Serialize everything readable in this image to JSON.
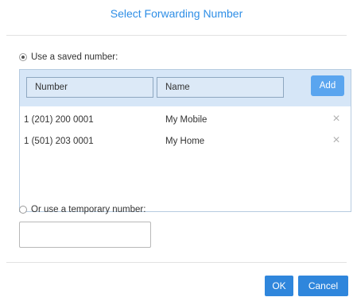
{
  "dialog": {
    "title": "Select Forwarding Number"
  },
  "saved": {
    "radio_label": "Use a saved number:",
    "selected": true,
    "columns": {
      "number": "Number",
      "name": "Name"
    },
    "add_label": "Add",
    "rows": [
      {
        "number": "1 (201) 200 0001",
        "name": "My Mobile",
        "remove_icon": "close-icon"
      },
      {
        "number": "1 (501) 203 0001",
        "name": "My Home",
        "remove_icon": "close-icon"
      }
    ]
  },
  "temporary": {
    "radio_label": "Or use a temporary number:",
    "selected": false,
    "value": "",
    "placeholder": ""
  },
  "footer": {
    "ok_label": "OK",
    "cancel_label": "Cancel"
  },
  "colors": {
    "accent": "#2f86dc",
    "title": "#2e8ee6",
    "add_button": "#5aa5ef",
    "table_header": "#d6e6f7"
  }
}
